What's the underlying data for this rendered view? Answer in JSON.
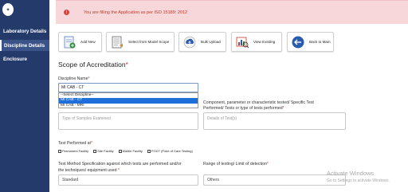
{
  "sidebar": {
    "logo_text": "✦",
    "items": [
      {
        "label": "Laboratory Details"
      },
      {
        "label": "Discipline Details"
      },
      {
        "label": "Enclosure"
      }
    ]
  },
  "alert": {
    "icon": "!",
    "text": "You are filling the Application as per ISO 15189: 2012"
  },
  "toolbar": {
    "add_new": "Add New",
    "select_model": "Select from Model Scope",
    "bulk_upload": "Bulk Upload",
    "view_existing": "View Existing",
    "back_main": "Back to Main"
  },
  "form": {
    "title": "Scope of Accreditation",
    "required_mark": "*",
    "discipline_label": "Discipline Name",
    "discipline_value": "MI CAB - CT",
    "discipline_options": [
      "--Select Discipline--",
      "MI CAB - CT",
      "MI CAB - MRI"
    ],
    "samples_placeholder": "Type of Samples Examined",
    "component_label_1": "Component, parameter or characteristic tested/ Specific Test",
    "component_label_2": "Performed/ Tests or type of tests performed",
    "details_placeholder": "Details of Test(s)",
    "test_performed_label": "Test Performed at",
    "test_performed_options": [
      "Permanent Facility",
      "Site Facility",
      "Mobile Facility",
      "POCT (Point of Care Testing)"
    ],
    "method_label_1": "Test Method Specification against which tests are performed and/or",
    "method_label_2": "the techniques/ equipment used",
    "method_value": "Standard",
    "range_label": "Range of testing/ Limit of detection",
    "range_value": "Others"
  },
  "watermark": {
    "line1": "Activate Windows",
    "line2": "Go to Settings to activate Windows."
  }
}
